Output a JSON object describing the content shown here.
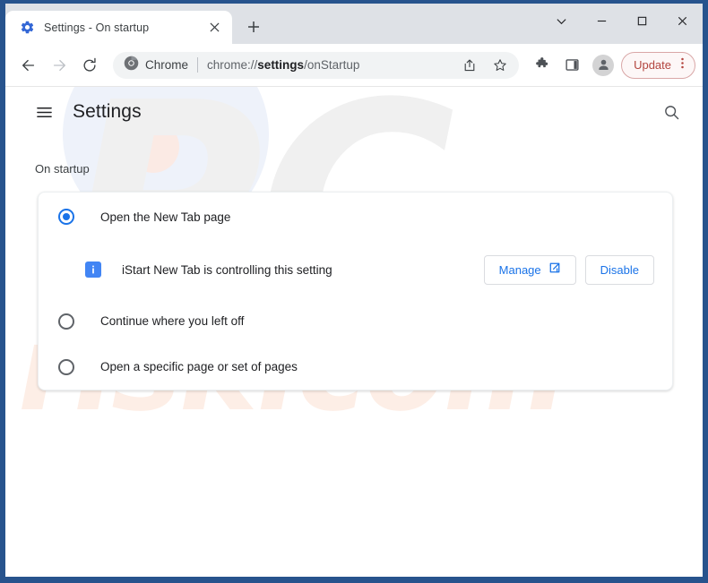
{
  "window": {
    "controls": {
      "tab_search": "chevron-down-icon",
      "minimize": "minimize-icon",
      "maximize": "maximize-icon",
      "close": "close-icon"
    }
  },
  "tab_strip": {
    "tabs": [
      {
        "title": "Settings - On startup",
        "favicon": "gear-icon",
        "active": true
      }
    ],
    "new_tab_label": "+"
  },
  "toolbar": {
    "back": "back-arrow-icon",
    "forward": "forward-arrow-icon",
    "reload": "reload-icon",
    "omnibox": {
      "brand_label": "Chrome",
      "brand_icon": "chrome-logo-icon",
      "url_prefix": "chrome://",
      "url_bold": "settings",
      "url_suffix": "/onStartup",
      "share_icon": "share-icon",
      "bookmark_icon": "star-icon"
    },
    "extensions_icon": "puzzle-icon",
    "side_panel_icon": "side-panel-icon",
    "avatar_icon": "profile-avatar-icon",
    "update": {
      "label": "Update",
      "menu_icon": "three-dots-vertical-icon",
      "border_color": "#d9a7a7",
      "text_color": "#b3453f"
    }
  },
  "settings": {
    "menu_icon": "hamburger-icon",
    "title": "Settings",
    "search_icon": "search-icon",
    "section_label": "On startup",
    "startup_options": [
      {
        "label": "Open the New Tab page",
        "checked": true
      },
      {
        "label": "Continue where you left off",
        "checked": false
      },
      {
        "label": "Open a specific page or set of pages",
        "checked": false
      }
    ],
    "controlled_notice": {
      "icon": "info-icon",
      "text": "iStart New Tab is controlling this setting",
      "manage_label": "Manage",
      "manage_icon": "external-link-icon",
      "disable_label": "Disable"
    },
    "accent_color": "#1a73e8"
  },
  "watermarks": {
    "primary": "PC",
    "secondary": "risk.com"
  }
}
